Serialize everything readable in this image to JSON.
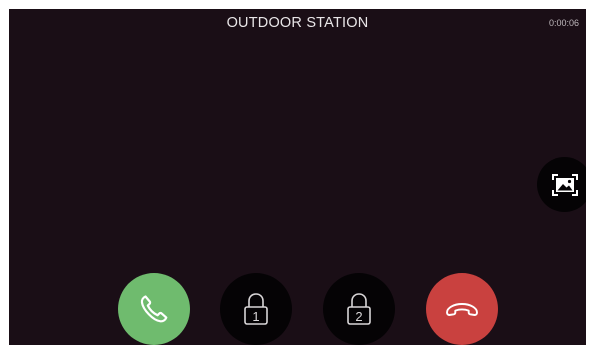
{
  "header": {
    "title": "OUTDOOR STATION",
    "call_timer": "0:00:06"
  },
  "controls": {
    "snapshot_icon": "image-capture-icon",
    "answer_icon": "phone-icon",
    "unlock_1_label": "1",
    "unlock_2_label": "2",
    "unlock_icon": "padlock-icon",
    "hangup_icon": "phone-hangup-icon"
  },
  "colors": {
    "background": "#1a0e16",
    "answer": "#6fbb6e",
    "hangup": "#c9413f",
    "neutral_button": "#050305",
    "text": "#e9e6e8"
  }
}
